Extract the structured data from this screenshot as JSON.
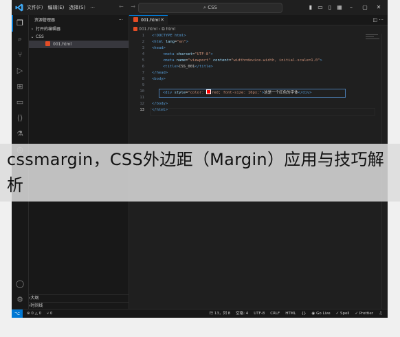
{
  "titlebar": {
    "menu": [
      "文件(F)",
      "编辑(E)",
      "选择(S)",
      "···"
    ],
    "nav_back": "←",
    "nav_forward": "→",
    "search": "CSS"
  },
  "sidebar": {
    "header": "资源管理器",
    "more": "···",
    "open_editors": "打开的编辑器",
    "folder": "CSS",
    "file": "001.html",
    "outline": "大纲",
    "timeline": "时间线"
  },
  "editor": {
    "tab_label": "001.html",
    "breadcrumb_file": "001.html",
    "breadcrumb_tag": "html",
    "lines": [
      "1",
      "2",
      "3",
      "4",
      "5",
      "6",
      "7",
      "8",
      "9",
      "10",
      "11",
      "12",
      "13"
    ],
    "code": {
      "l1": "<!DOCTYPE html>",
      "l2_tag": "<html ",
      "l2_attr": "lang",
      "l2_val": "\"en\"",
      "l3": "<head>",
      "l4_tag": "<meta ",
      "l4_attr": "charset",
      "l4_val": "\"UTF-8\"",
      "l5_tag": "<meta ",
      "l5_attr1": "name",
      "l5_val1": "\"viewport\"",
      "l5_attr2": "content",
      "l5_val2": "\"width=device-width, initial-scale=1.0\"",
      "l6_open": "<title>",
      "l6_text": "CSS_001",
      "l6_close": "</title>",
      "l7": "</head>",
      "l8": "<body>",
      "l10_tag": "<div ",
      "l10_attr": "style",
      "l10_val_a": "\"color: ",
      "l10_val_b": "red; font-size: 16px;\"",
      "l10_text": "这是一个红色的字体",
      "l10_close": "</div>",
      "l12": "</body>",
      "l13": "</html>"
    }
  },
  "statusbar": {
    "remote": "⌥",
    "errors": "⊗ 0 △ 0",
    "ports": "⑂ 0",
    "position": "行 13，列 8",
    "spaces": "空格: 4",
    "encoding": "UTF-8",
    "eol": "CRLF",
    "language": "HTML",
    "golive": "Go Live",
    "spell": "Spell",
    "prettier": "Prettier"
  },
  "caption": "cssmargin，CSS外边距（Margin）应用与技巧解析",
  "colors": {
    "accent": "#0078d4",
    "html_icon": "#e44d26",
    "swatch": "#ff0000"
  }
}
